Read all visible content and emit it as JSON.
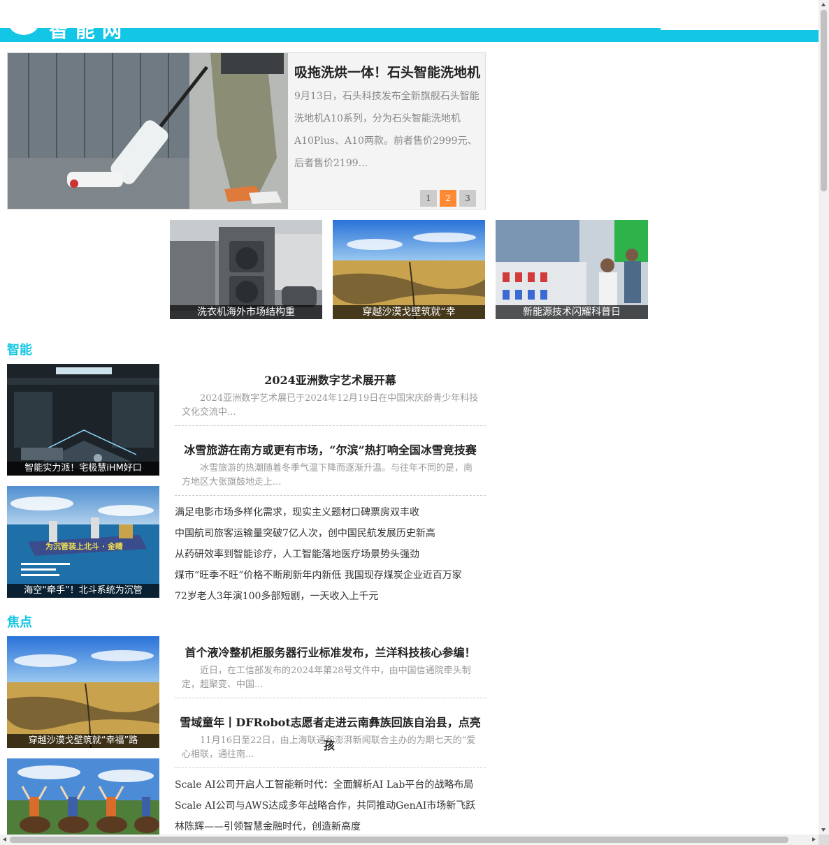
{
  "header": {
    "logo_text": "智能网",
    "colors": {
      "accent": "#13c6e5"
    }
  },
  "slider": {
    "title": "吸拖洗烘一体！石头智能洗地机",
    "desc": "9月13日，石头科技发布全新旗舰石头智能洗地机A10系列，分为石头智能洗地机A10Plus、A10两款。前者售价2999元、后者售价2199...",
    "pages": [
      "1",
      "2",
      "3"
    ],
    "active_page": 2,
    "image_icon": "floor-washer-photo"
  },
  "tiles": [
    {
      "caption": "洗衣机海外市场结构重",
      "image_icon": "laundry-room-photo"
    },
    {
      "caption": "穿越沙漠戈壁筑就“幸",
      "image_icon": "desert-road-photo"
    },
    {
      "caption": "新能源技术闪耀科普日",
      "image_icon": "exhibition-photo"
    }
  ],
  "sections": [
    {
      "title": "智能",
      "thumbs": [
        {
          "caption": "智能实力派！宅极慧iHM好口",
          "image_icon": "smart-home-photo"
        },
        {
          "caption": "海空“牵手”！北斗系统为沉管",
          "image_icon": "ship-sea-photo"
        }
      ],
      "features": [
        {
          "title": "2024亚洲数字艺术展开幕",
          "desc": "2024亚洲数字艺术展已于2024年12月19日在中国宋庆龄青少年科技文化交流中..."
        },
        {
          "title": "冰雪旅游在南方或更有市场，“尔滨”热打响全国冰雪竞技赛",
          "desc": "冰雪旅游的热潮随着冬季气温下降而逐渐升温。与往年不同的是，南方地区大张旗鼓地走上..."
        }
      ],
      "list": [
        "满足电影市场多样化需求，现实主义题材口碑票房双丰收",
        "中国航司旅客运输量突破7亿人次，创中国民航发展历史新高",
        "从药研效率到智能诊疗，人工智能落地医疗场景势头强劲",
        "煤市“旺季不旺”价格不断刷新年内新低 我国现存煤炭企业近百万家",
        "72岁老人3年演100多部短剧，一天收入上千元"
      ]
    },
    {
      "title": "焦点",
      "thumbs": [
        {
          "caption": "穿越沙漠戈壁筑就“幸福”路",
          "image_icon": "desert-road-photo"
        },
        {
          "caption": "",
          "image_icon": "horse-riders-photo"
        }
      ],
      "features": [
        {
          "title": "首个液冷整机柜服务器行业标准发布，兰洋科技核心参编！",
          "desc": "近日，在工信部发布的2024年第28号文件中，由中国信通院牵头制定，超聚变、中国..."
        },
        {
          "title": "雪域童年丨DFRobot志愿者走进云南彝族回族自治县，点亮",
          "overflow": "孩",
          "desc": "11月16日至22日，由上海联通和澎湃新闻联合主办的为期七天的“爱心相联，通往南..."
        }
      ],
      "list": [
        "Scale AI公司开启人工智能新时代：全面解析AI Lab平台的战略布局",
        "Scale AI公司与AWS达成多年战略合作，共同推动GenAI市场新飞跃",
        "林陈辉——引领智慧金融时代，创造新高度"
      ]
    }
  ]
}
